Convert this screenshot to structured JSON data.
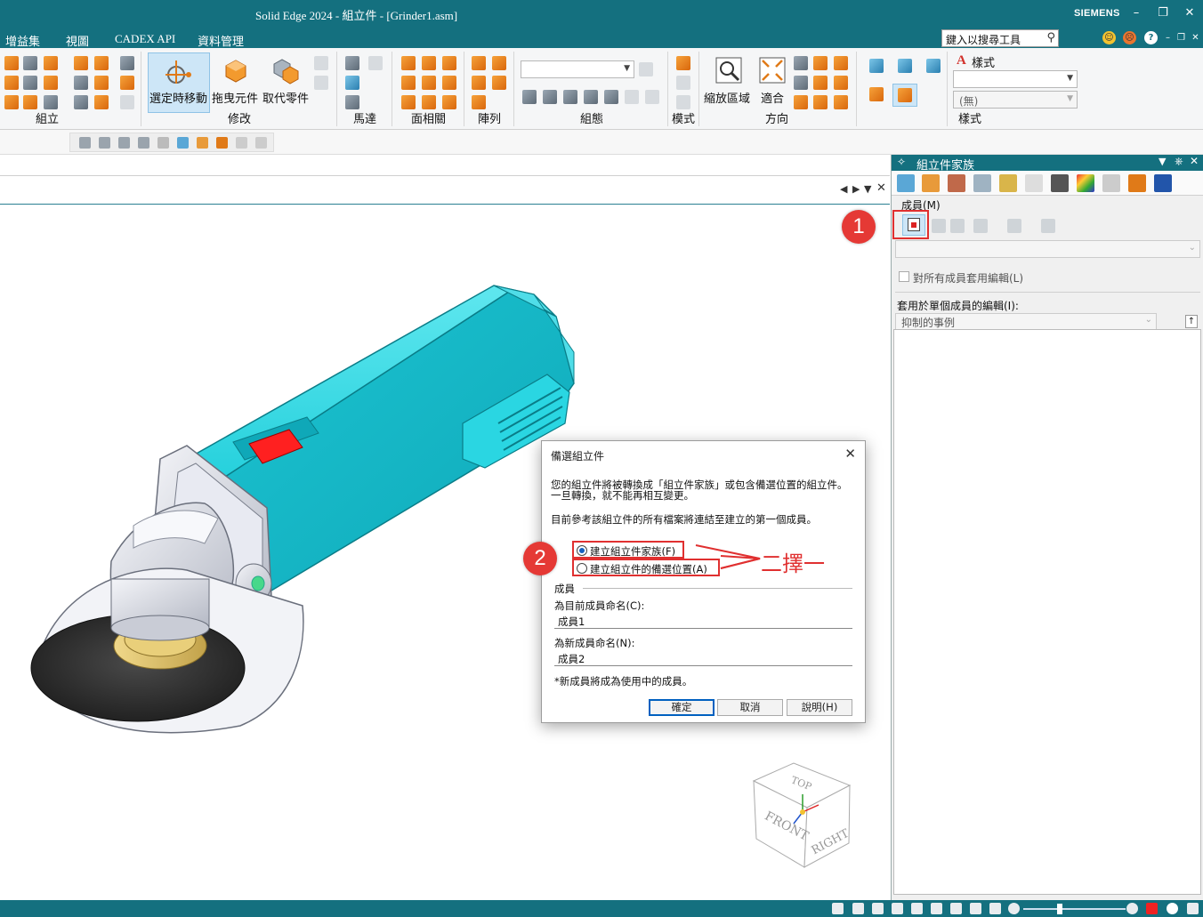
{
  "window": {
    "title": "Solid Edge 2024 - 組立件 - [Grinder1.asm]",
    "brand": "SIEMENS"
  },
  "menu": {
    "items": [
      "增益集",
      "視圖",
      "CADEX API",
      "資料管理"
    ],
    "search_placeholder": "鍵入以搜尋工具"
  },
  "ribbon": {
    "groups": {
      "assemble": "組立",
      "modify": "修改",
      "motor": "馬達",
      "face_rel": "面相關",
      "pattern": "陣列",
      "config": "組態",
      "mode": "模式",
      "orient": "方向",
      "style": "樣式"
    },
    "buttons": {
      "select_move": "選定時移動",
      "drag_component": "拖曳元件",
      "replace_part": "取代零件",
      "zoom_area": "縮放區域",
      "fit": "適合",
      "style_label": "樣式",
      "style_value": "(無)"
    }
  },
  "pane": {
    "title": "組立件家族",
    "members_label": "成員(M)",
    "apply_all_label": "對所有成員套用編輯(L)",
    "single_edit_label": "套用於單個成員的編輯(I):",
    "single_edit_value": "抑制的事例"
  },
  "dialog": {
    "title": "備選組立件",
    "line1": "您的組立件將被轉換成「組立件家族」或包含備選位置的組立件。",
    "line2": "一旦轉換，就不能再相互變更。",
    "line3": "目前參考該組立件的所有檔案將連結至建立的第一個成員。",
    "option_family": "建立組立件家族(F)",
    "option_alt_pos": "建立組立件的備選位置(A)",
    "section_member": "成員",
    "current_name_label": "為目前成員命名(C):",
    "current_name_value": "成員1",
    "new_name_label": "為新成員命名(N):",
    "new_name_value": "成員2",
    "note": "*新成員將成為使用中的成員。",
    "ok": "確定",
    "cancel": "取消",
    "help": "說明(H)"
  },
  "annotations": {
    "callout1": "1",
    "callout2": "2",
    "choose_one": "二擇一"
  },
  "viewcube": {
    "top": "TOP",
    "front": "FRONT",
    "right": "RIGHT"
  },
  "colors": {
    "accent": "#14707f",
    "annotation_red": "#e03030",
    "model_body": "#22d3df"
  }
}
